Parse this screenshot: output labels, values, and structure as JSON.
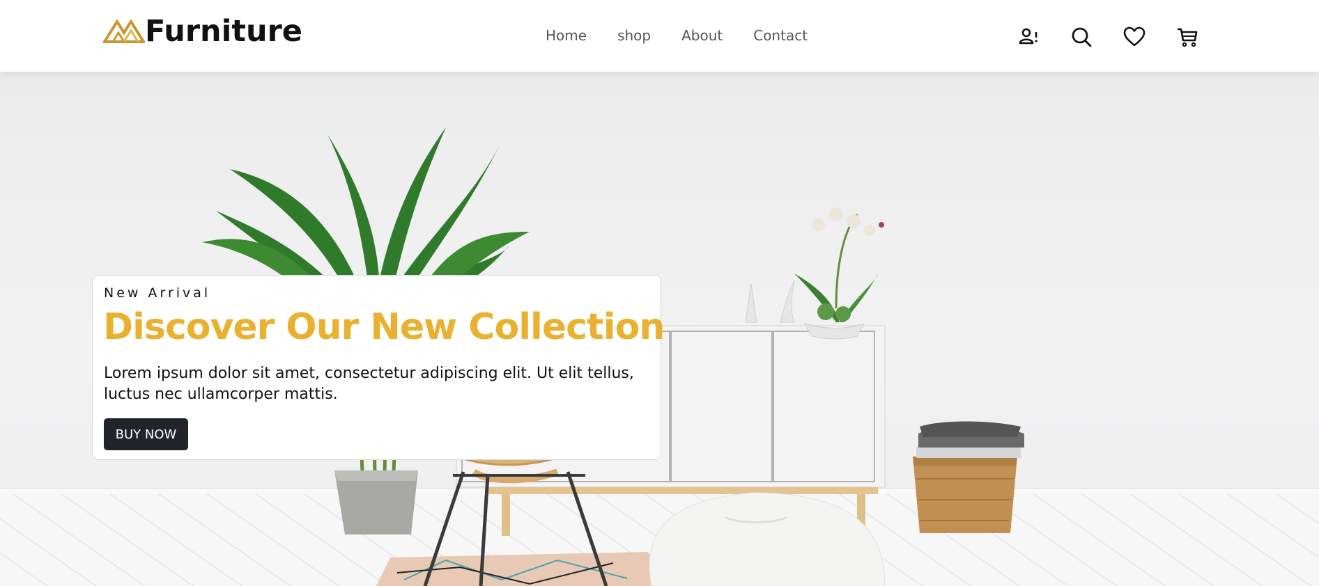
{
  "brand": {
    "name": "Furniture",
    "accent": "#e9b12f"
  },
  "nav": {
    "items": [
      "Home",
      "shop",
      "About",
      "Contact"
    ]
  },
  "header_icons": [
    "user-icon",
    "search-icon",
    "heart-icon",
    "cart-icon"
  ],
  "hero": {
    "eyebrow": "New Arrival",
    "headline": "Discover Our New Collection",
    "description": "Lorem ipsum dolor sit amet, consectetur adipiscing elit. Ut elit tellus, luctus nec ullamcorper mattis.",
    "cta_label": "BUY NOW",
    "cta_color": "#21252a"
  }
}
